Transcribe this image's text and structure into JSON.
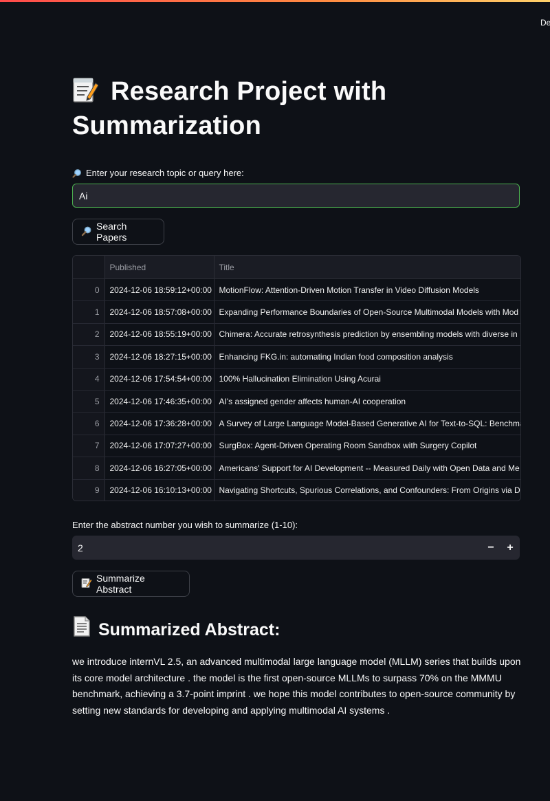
{
  "header": {
    "deploy_label": "De"
  },
  "page": {
    "title": "Research Project with Summarization"
  },
  "search": {
    "label": "Enter your research topic or query here:",
    "value": "Ai",
    "button_label": "Search Papers"
  },
  "results": {
    "columns": [
      "",
      "Published",
      "Title"
    ],
    "rows": [
      {
        "index": "0",
        "published": "2024-12-06 18:59:12+00:00",
        "title": "MotionFlow: Attention-Driven Motion Transfer in Video Diffusion Models"
      },
      {
        "index": "1",
        "published": "2024-12-06 18:57:08+00:00",
        "title": "Expanding Performance Boundaries of Open-Source Multimodal Models with Mod"
      },
      {
        "index": "2",
        "published": "2024-12-06 18:55:19+00:00",
        "title": "Chimera: Accurate retrosynthesis prediction by ensembling models with diverse in"
      },
      {
        "index": "3",
        "published": "2024-12-06 18:27:15+00:00",
        "title": "Enhancing FKG.in: automating Indian food composition analysis"
      },
      {
        "index": "4",
        "published": "2024-12-06 17:54:54+00:00",
        "title": "100% Hallucination Elimination Using Acurai"
      },
      {
        "index": "5",
        "published": "2024-12-06 17:46:35+00:00",
        "title": "AI's assigned gender affects human-AI cooperation"
      },
      {
        "index": "6",
        "published": "2024-12-06 17:36:28+00:00",
        "title": "A Survey of Large Language Model-Based Generative AI for Text-to-SQL: Benchmar"
      },
      {
        "index": "7",
        "published": "2024-12-06 17:07:27+00:00",
        "title": "SurgBox: Agent-Driven Operating Room Sandbox with Surgery Copilot"
      },
      {
        "index": "8",
        "published": "2024-12-06 16:27:05+00:00",
        "title": "Americans' Support for AI Development -- Measured Daily with Open Data and Me"
      },
      {
        "index": "9",
        "published": "2024-12-06 16:10:13+00:00",
        "title": "Navigating Shortcuts, Spurious Correlations, and Confounders: From Origins via D"
      }
    ]
  },
  "summarize": {
    "label": "Enter the abstract number you wish to summarize (1-10):",
    "value": "2",
    "minus_label": "−",
    "plus_label": "+",
    "button_label": "Summarize Abstract"
  },
  "summary": {
    "heading": "Summarized Abstract:",
    "text": "we introduce internVL 2.5, an advanced multimodal large language model (MLLM) series that builds upon its core model architecture . the model is the first open-source MLLMs to surpass 70% on the MMMU benchmark, achieving a 3.7-point imprint . we hope this model contributes to open-source community by setting new standards for developing and applying multimodal AI systems ."
  },
  "theme": {
    "background": "#0e1117",
    "input_background": "#262730",
    "focus_border": "#4caf50",
    "accent_gradient_start": "#ff4b4b",
    "accent_gradient_end": "#ffd16a"
  }
}
